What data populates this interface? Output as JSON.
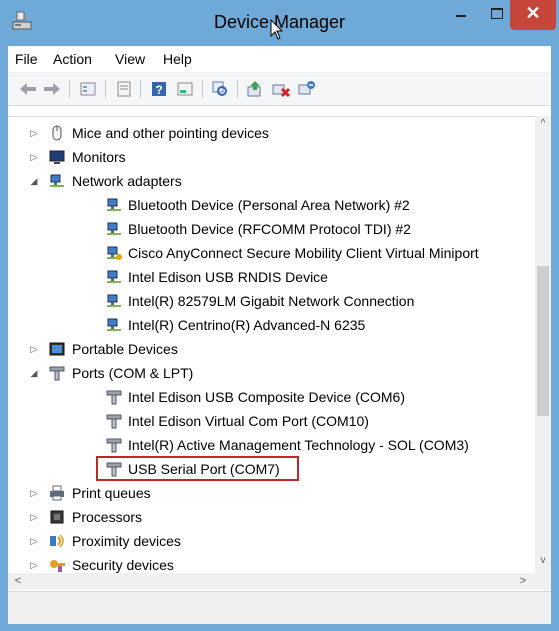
{
  "window": {
    "title": "Device Manager",
    "accent_color": "#6fa9d8",
    "close_color": "#c7463b"
  },
  "titlebar_buttons": {
    "minimize": "minimize-icon",
    "maximize": "maximize-icon",
    "close": "✕"
  },
  "menu": [
    "File",
    "Action",
    "View",
    "Help"
  ],
  "toolbar": [
    "back-icon",
    "forward-icon",
    "properties-icon",
    "update-icon",
    "help-icon",
    "show-hidden-icon",
    "scan-icon",
    "update-driver-icon",
    "disable-icon",
    "uninstall-icon"
  ],
  "tree": {
    "categories": [
      {
        "label": "Mice and other pointing devices",
        "expanded": false,
        "icon": "mouse-icon"
      },
      {
        "label": "Monitors",
        "expanded": false,
        "icon": "monitor-icon"
      },
      {
        "label": "Network adapters",
        "expanded": true,
        "icon": "network-icon",
        "children": [
          "Bluetooth Device (Personal Area Network) #2",
          "Bluetooth Device (RFCOMM Protocol TDI) #2",
          "Cisco AnyConnect Secure Mobility Client Virtual Miniport",
          "Intel Edison USB RNDIS Device",
          "Intel(R) 82579LM Gigabit Network Connection",
          "Intel(R) Centrino(R) Advanced-N 6235"
        ]
      },
      {
        "label": "Portable Devices",
        "expanded": false,
        "icon": "portable-device-icon"
      },
      {
        "label": "Ports (COM & LPT)",
        "expanded": true,
        "icon": "port-icon",
        "children": [
          "Intel Edison USB Composite Device (COM6)",
          "Intel Edison Virtual Com Port (COM10)",
          "Intel(R) Active Management Technology - SOL (COM3)",
          "USB Serial Port (COM7)"
        ]
      },
      {
        "label": "Print queues",
        "expanded": false,
        "icon": "printer-icon"
      },
      {
        "label": "Processors",
        "expanded": false,
        "icon": "processor-icon"
      },
      {
        "label": "Proximity devices",
        "expanded": false,
        "icon": "proximity-icon"
      },
      {
        "label": "Security devices",
        "expanded": false,
        "icon": "security-icon"
      }
    ],
    "highlighted": "USB Serial Port (COM7)",
    "highlight_color": "#c0272d"
  },
  "scrollbar": {
    "up": "^",
    "down": "v",
    "left": "<",
    "right": ">"
  }
}
